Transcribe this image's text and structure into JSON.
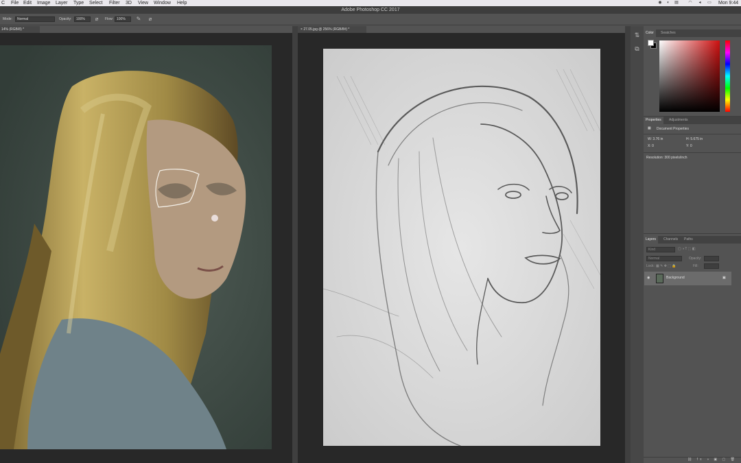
{
  "menubar": {
    "apple": "",
    "app": "C",
    "items": [
      "File",
      "Edit",
      "Image",
      "Layer",
      "Type",
      "Select",
      "Filter",
      "3D",
      "View",
      "Window",
      "Help"
    ],
    "clock": "Mon 9:44"
  },
  "window_title": "Adobe Photoshop CC 2017",
  "options": {
    "mode_label": "Mode:",
    "mode_value": "Normal",
    "opacity_label": "Opacity:",
    "opacity_value": "100%",
    "flow_label": "Flow:",
    "flow_value": "100%"
  },
  "documents": {
    "tab1": "14% (RGB/8) *",
    "tab2_close": "×",
    "tab2": "27.05.jpg @ 256% (RGB/8#) *"
  },
  "color_panel": {
    "tabs": [
      "Color",
      "Swatches"
    ],
    "foreground": "#ffffff",
    "background": "#000000"
  },
  "properties_panel": {
    "tabs": [
      "Properties",
      "Adjustments"
    ],
    "heading": "Document Properties",
    "w": "W: 3.76 in",
    "h": "H: 5.675 in",
    "x": "X: 0",
    "y": "Y: 0",
    "resolution": "Resolution: 300 pixels/inch"
  },
  "layers_panel": {
    "tabs": [
      "Layers",
      "Channels",
      "Paths"
    ],
    "kind_placeholder": "Kind",
    "blend_mode": "Normal",
    "opacity_label": "Opacity:",
    "lock_label": "Lock:",
    "fill_label": "Fill:",
    "layer_name": "Background"
  }
}
